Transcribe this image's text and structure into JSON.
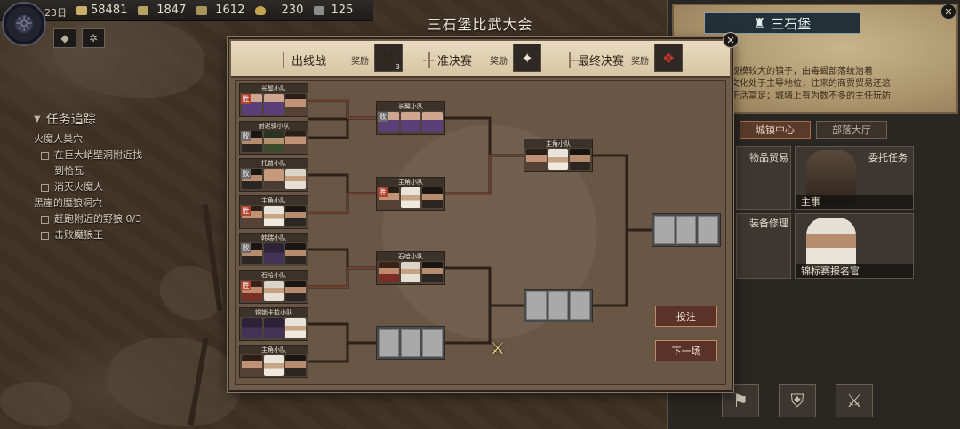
{
  "hud": {
    "day": "23日",
    "resources": [
      "58481",
      "1847",
      "1612",
      "230",
      "125"
    ]
  },
  "quest": {
    "title": "任务追踪",
    "items": [
      {
        "text": "火魔人巢穴",
        "indent": false,
        "box": false
      },
      {
        "text": "在巨大峭壁洞附近找",
        "indent": true,
        "box": true
      },
      {
        "text": "到恰瓦",
        "indent": true,
        "box": false
      },
      {
        "text": "消灭火魔人",
        "indent": true,
        "box": true
      },
      {
        "text": "黑崖的魔狼洞穴",
        "indent": false,
        "box": false
      },
      {
        "text": "赶跑附近的野狼 0/3",
        "indent": true,
        "box": true
      },
      {
        "text": "击败魔狼王",
        "indent": true,
        "box": true
      }
    ]
  },
  "town": {
    "name": "三石堡",
    "desc_lines": [
      "规模较大的镇子，由毒蝎部落统治着",
      "文化处于主导地位；往来的商贾贸易还这",
      "于活富足；城墙上有为数不多的主任玩防"
    ],
    "tabs": [
      "城镇中心",
      "部落大厅"
    ],
    "cards": [
      {
        "label": "物品贸易",
        "foot": ""
      },
      {
        "label": "委托任务",
        "foot": "主事"
      },
      {
        "label": "装备修理",
        "foot": ""
      },
      {
        "label": "",
        "foot": "锦标赛报名官"
      }
    ]
  },
  "dialog": {
    "title": "三石堡比武大会",
    "stages": [
      {
        "name": "出线战",
        "reward": "奖励",
        "prize_icon": "hammer-icon",
        "count": "3"
      },
      {
        "name": "准决赛",
        "reward": "奖励",
        "prize_icon": "scroll-icon",
        "count": ""
      },
      {
        "name": "最终决赛",
        "reward": "奖励",
        "prize_icon": "armor-icon",
        "count": ""
      }
    ],
    "round1": [
      {
        "name": "长鬓小队",
        "result": "胜",
        "faces": [
          "f-purple",
          "f-purple",
          "f-brown"
        ]
      },
      {
        "name": "耐迟骑小队",
        "result": "败",
        "faces": [
          "f-dark",
          "f-green",
          "f-brown"
        ]
      },
      {
        "name": "托普小队",
        "result": "败",
        "faces": [
          "f-dark",
          "f-bald",
          "f-light"
        ]
      },
      {
        "name": "主角小队",
        "result": "胜",
        "faces": [
          "f-brown",
          "f-white",
          "f-dark"
        ]
      },
      {
        "name": "韩瑞小队",
        "result": "败",
        "faces": [
          "f-dark",
          "f-hood",
          "f-dark"
        ]
      },
      {
        "name": "石哈小队",
        "result": "胜",
        "faces": [
          "f-red",
          "f-light",
          "f-dark"
        ]
      },
      {
        "name": "铜锁卡拉小队",
        "result": "",
        "faces": [
          "f-hood",
          "f-hood",
          "f-white"
        ]
      },
      {
        "name": "主角小队",
        "result": "",
        "faces": [
          "f-brown",
          "f-white",
          "f-dark"
        ]
      }
    ],
    "round2": [
      {
        "name": "长鬓小队",
        "result": "败",
        "faces": [
          "f-purple",
          "f-purple",
          "f-purple"
        ]
      },
      {
        "name": "主角小队",
        "result": "胜",
        "faces": [
          "f-brown",
          "f-white",
          "f-dark"
        ]
      },
      {
        "name": "石哈小队",
        "result": "",
        "faces": [
          "f-red",
          "f-light",
          "f-dark"
        ]
      }
    ],
    "round3": [
      {
        "name": "主角小队",
        "result": "",
        "faces": [
          "f-brown",
          "f-white",
          "f-dark"
        ]
      }
    ],
    "bet_label": "投注",
    "next_label": "下一场"
  }
}
